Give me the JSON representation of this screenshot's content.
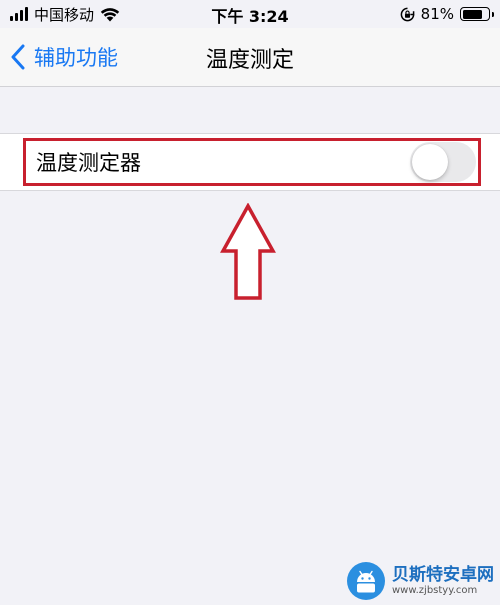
{
  "status_bar": {
    "carrier": "中国移动",
    "time": "下午 3:24",
    "battery_percent": "81%",
    "battery_level": 0.81,
    "icons": [
      "signal-icon",
      "wifi-icon",
      "orientation-lock-icon",
      "battery-icon"
    ]
  },
  "nav": {
    "back_label": "辅助功能",
    "title": "温度测定"
  },
  "setting": {
    "label": "温度测定器",
    "toggle_on": false
  },
  "annotation": {
    "color": "#c8202e",
    "icons": [
      "highlight-box",
      "up-arrow-icon"
    ]
  },
  "watermark": {
    "title": "贝斯特安卓网",
    "url": "www.zjbstyy.com"
  },
  "colors": {
    "background": "#f2f2f7",
    "accent": "#1878f3",
    "toggle_off": "#e9e9eb"
  }
}
